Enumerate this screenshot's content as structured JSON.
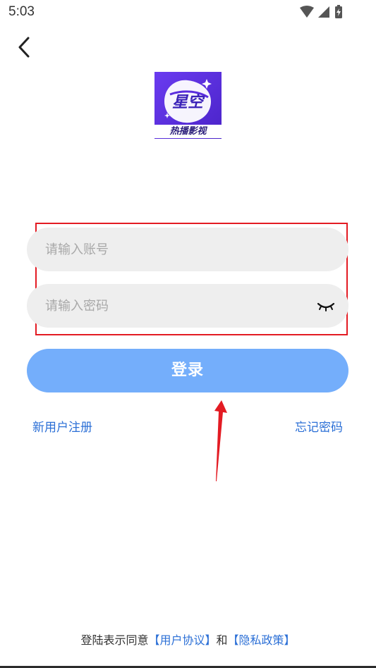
{
  "status_bar": {
    "time": "5:03"
  },
  "logo": {
    "title": "星空",
    "subtitle": "热播影视",
    "bg_color": "#5b2dde"
  },
  "form": {
    "account_placeholder": "请输入账号",
    "password_placeholder": "请输入密码",
    "login_label": "登录",
    "register_label": "新用户注册",
    "forgot_label": "忘记密码"
  },
  "agreement": {
    "prefix": "登陆表示同意",
    "user_agreement": "【用户协议】",
    "connector": "和",
    "privacy_policy": "【隐私政策】"
  },
  "colors": {
    "accent": "#74aefb",
    "link": "#2b6fd6",
    "annotation": "#e31b23"
  },
  "icons": [
    "back-icon",
    "wifi-icon",
    "signal-icon",
    "battery-icon",
    "eye-closed-icon"
  ]
}
